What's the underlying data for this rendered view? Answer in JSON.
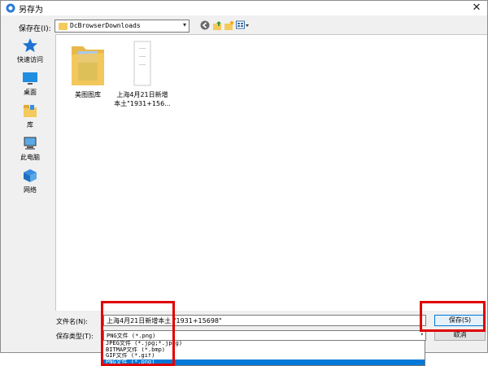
{
  "window": {
    "title": "另存为",
    "close_glyph": "✕"
  },
  "location": {
    "label": "保存在(I):",
    "value": "DcBrowserDownloads"
  },
  "sidebar": {
    "items": [
      {
        "label": "快速访问",
        "icon": "star-icon"
      },
      {
        "label": "桌面",
        "icon": "desktop-icon"
      },
      {
        "label": "库",
        "icon": "library-icon"
      },
      {
        "label": "此电脑",
        "icon": "computer-icon"
      },
      {
        "label": "网络",
        "icon": "network-icon"
      }
    ]
  },
  "files": [
    {
      "name": "美图图库",
      "type": "folder"
    },
    {
      "name_line1": "上海4月21日新增",
      "name_line2": "本土\"1931+156...",
      "type": "image-file"
    }
  ],
  "filename": {
    "label": "文件名(N):",
    "value": "上海4月21日新增本土 \"1931+15698\""
  },
  "filetype": {
    "label": "保存类型(T):",
    "value": "PNG文件 (*.png)",
    "options": [
      "JPEG文件 (*.jpg;*.jpeg)",
      "BITMAP文件 (*.bmp)",
      "GIF文件 (*.gif)",
      "PNG文件 (*.png)"
    ],
    "selected_index": 3
  },
  "buttons": {
    "save": "保存(S)",
    "cancel": "取消"
  },
  "colors": {
    "highlight": "#0078d7",
    "annotation_red": "#e00000",
    "folder": "#f4c95e"
  }
}
